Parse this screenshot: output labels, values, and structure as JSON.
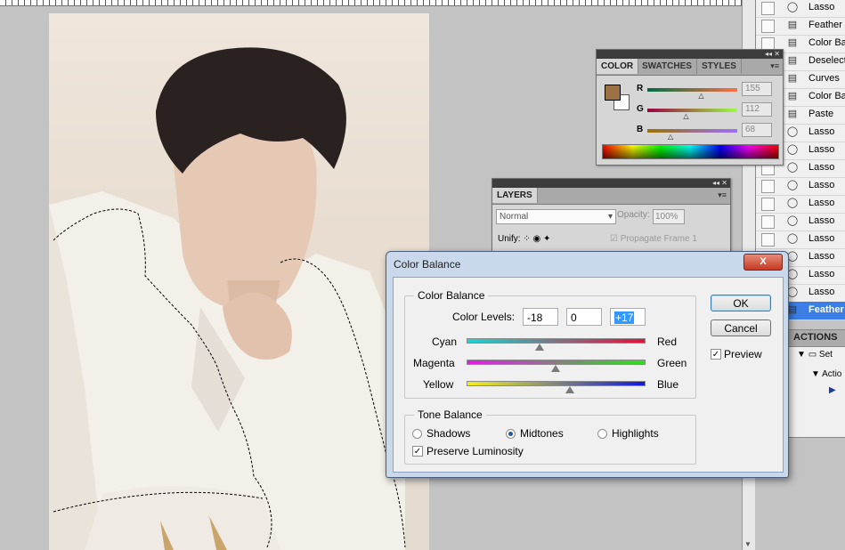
{
  "history": {
    "items": [
      {
        "label": "Lasso",
        "icon": "lasso-icon",
        "partial": true
      },
      {
        "label": "Feather",
        "icon": "document-icon"
      },
      {
        "label": "Color Bala",
        "icon": "document-icon"
      },
      {
        "label": "Deselect",
        "icon": "document-icon"
      },
      {
        "label": "Curves",
        "icon": "document-icon"
      },
      {
        "label": "Color Bala",
        "icon": "document-icon"
      },
      {
        "label": "Paste",
        "icon": "document-icon"
      },
      {
        "label": "Lasso",
        "icon": "lasso-icon"
      },
      {
        "label": "Lasso",
        "icon": "lasso-icon"
      },
      {
        "label": "Lasso",
        "icon": "lasso-icon"
      },
      {
        "label": "Lasso",
        "icon": "lasso-icon"
      },
      {
        "label": "Lasso",
        "icon": "lasso-icon"
      },
      {
        "label": "Lasso",
        "icon": "lasso-icon"
      },
      {
        "label": "Lasso",
        "icon": "lasso-icon"
      },
      {
        "label": "Lasso",
        "icon": "lasso-icon"
      },
      {
        "label": "Lasso",
        "icon": "lasso-icon"
      },
      {
        "label": "Lasso",
        "icon": "lasso-icon"
      },
      {
        "label": "Feather",
        "icon": "document-icon",
        "selected": true
      }
    ]
  },
  "actions": {
    "tab": "ACTIONS",
    "set_label": "Set",
    "action_label": "Actio"
  },
  "color_panel": {
    "tabs": [
      "COLOR",
      "SWATCHES",
      "STYLES"
    ],
    "channels": [
      {
        "name": "R",
        "value": "155",
        "level": 0.608
      },
      {
        "name": "G",
        "value": "112",
        "level": 0.439
      },
      {
        "name": "B",
        "value": "68",
        "level": 0.267
      }
    ],
    "foreground": "#9b7044"
  },
  "layers_panel": {
    "tab": "LAYERS",
    "blend_mode": "Normal",
    "opacity_label": "Opacity:",
    "opacity_value": "100%",
    "unify_label": "Unify:",
    "propagate_label": "Propagate Frame 1"
  },
  "dialog": {
    "title": "Color Balance",
    "close": "X",
    "group_color": "Color Balance",
    "levels_label": "Color Levels:",
    "levels": [
      "-18",
      "0",
      "+17"
    ],
    "sliders": [
      {
        "left": "Cyan",
        "right": "Red",
        "level": -0.18
      },
      {
        "left": "Magenta",
        "right": "Green",
        "level": 0
      },
      {
        "left": "Yellow",
        "right": "Blue",
        "level": 0.17
      }
    ],
    "group_tone": "Tone Balance",
    "tones": [
      "Shadows",
      "Midtones",
      "Highlights"
    ],
    "selected_tone": "Midtones",
    "preserve": "Preserve Luminosity",
    "ok": "OK",
    "cancel": "Cancel",
    "preview": "Preview"
  }
}
